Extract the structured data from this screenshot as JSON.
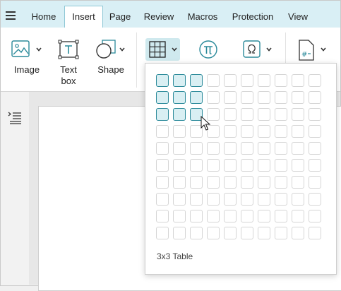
{
  "tabs": [
    {
      "label": "Home"
    },
    {
      "label": "Insert"
    },
    {
      "label": "Page"
    },
    {
      "label": "Review"
    },
    {
      "label": "Macros"
    },
    {
      "label": "Protection"
    },
    {
      "label": "View"
    }
  ],
  "ribbon": {
    "image_label": "Image",
    "textbox_label_1": "Text",
    "textbox_label_2": "box",
    "shape_label": "Shape"
  },
  "table_picker": {
    "selected_rows": 3,
    "selected_cols": 3,
    "total_rows": 10,
    "total_cols": 10,
    "status": "3x3 Table"
  },
  "colors": {
    "accent": "#2b8a9a",
    "tabbar": "#d9eff5",
    "selected_cell": "#d9eff3"
  },
  "icons": [
    "menu-icon",
    "image-icon",
    "textbox-icon",
    "shape-icon",
    "table-icon",
    "pi-icon",
    "omega-icon",
    "page-number-icon",
    "outline-icon",
    "cursor-icon"
  ]
}
